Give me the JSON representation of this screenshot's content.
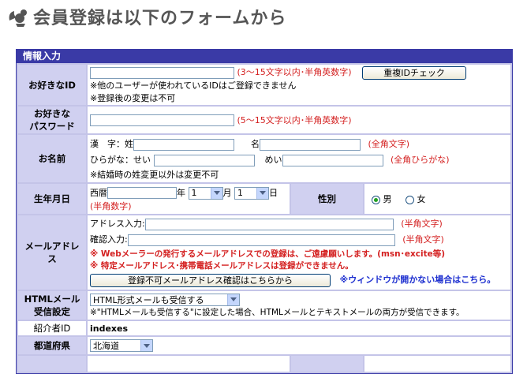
{
  "header": {
    "title": "会員登録は以下のフォームから",
    "mascot_icon": "squirrel-icon"
  },
  "section": {
    "title": "情報入力"
  },
  "id": {
    "label": "お好きなID",
    "value": "",
    "hint": "(3～15文字以内･半角英数字)",
    "check_button": "重複IDチェック",
    "note1": "※他のユーザーが使われているIDはご登録できません",
    "note2": "※登録後の変更は不可"
  },
  "password": {
    "label_line1": "お好きな",
    "label_line2": "パスワード",
    "value": "",
    "hint": "(5～15文字以内･半角英数字)"
  },
  "name": {
    "label": "お名前",
    "kanji_label": "漢　字：姓",
    "mei_label": "名",
    "kanji_hint": "(全角文字)",
    "kana_label": "ひらがな：せい",
    "kana_mei_label": "めい",
    "kana_hint": "(全角ひらがな)",
    "note": "※結婚時の姓変更以外は変更不可"
  },
  "birthday": {
    "label": "生年月日",
    "era": "西暦",
    "year_label": "年",
    "month_value": "1",
    "month_label": "月",
    "day_value": "1",
    "day_label": "日",
    "hint": "(半角数字)"
  },
  "gender": {
    "label": "性別",
    "male": "男",
    "female": "女",
    "selected": "男"
  },
  "email": {
    "label": "メールアドレス",
    "input_label": "アドレス入力:",
    "confirm_label": "確認入力:",
    "hint1": "(半角文字)",
    "hint2": "(半角文字)",
    "warning1": "※ Webメーラーの発行するメールアドレスでの登録は、ご遠慮願いします。(msn･excite等)",
    "warning2": "※ 特定メールアドレス･携帯電話メールアドレスは登録ができません。",
    "check_button": "登録不可メールアドレス確認はこちらから",
    "window_note": "※ウィンドウが開かない場合はこちら。"
  },
  "html_mail": {
    "label_line1": "HTMLメール",
    "label_line2": "受信設定",
    "selected": "HTML形式メールも受信する",
    "note": "※\"HTMLメールも受信する\"に設定した場合、HTMLメールとテキストメールの両方が受信できます。"
  },
  "referrer": {
    "label": "紹介者ID",
    "value": "indexes"
  },
  "prefecture": {
    "label": "都道府県",
    "selected": "北海道"
  },
  "colors": {
    "section_bg": "#3a3aa6",
    "label_bg": "#d0d0f0",
    "frame_bg": "#c4c4e8",
    "hint_red": "#d42020",
    "link_blue": "#1d2fd0"
  }
}
